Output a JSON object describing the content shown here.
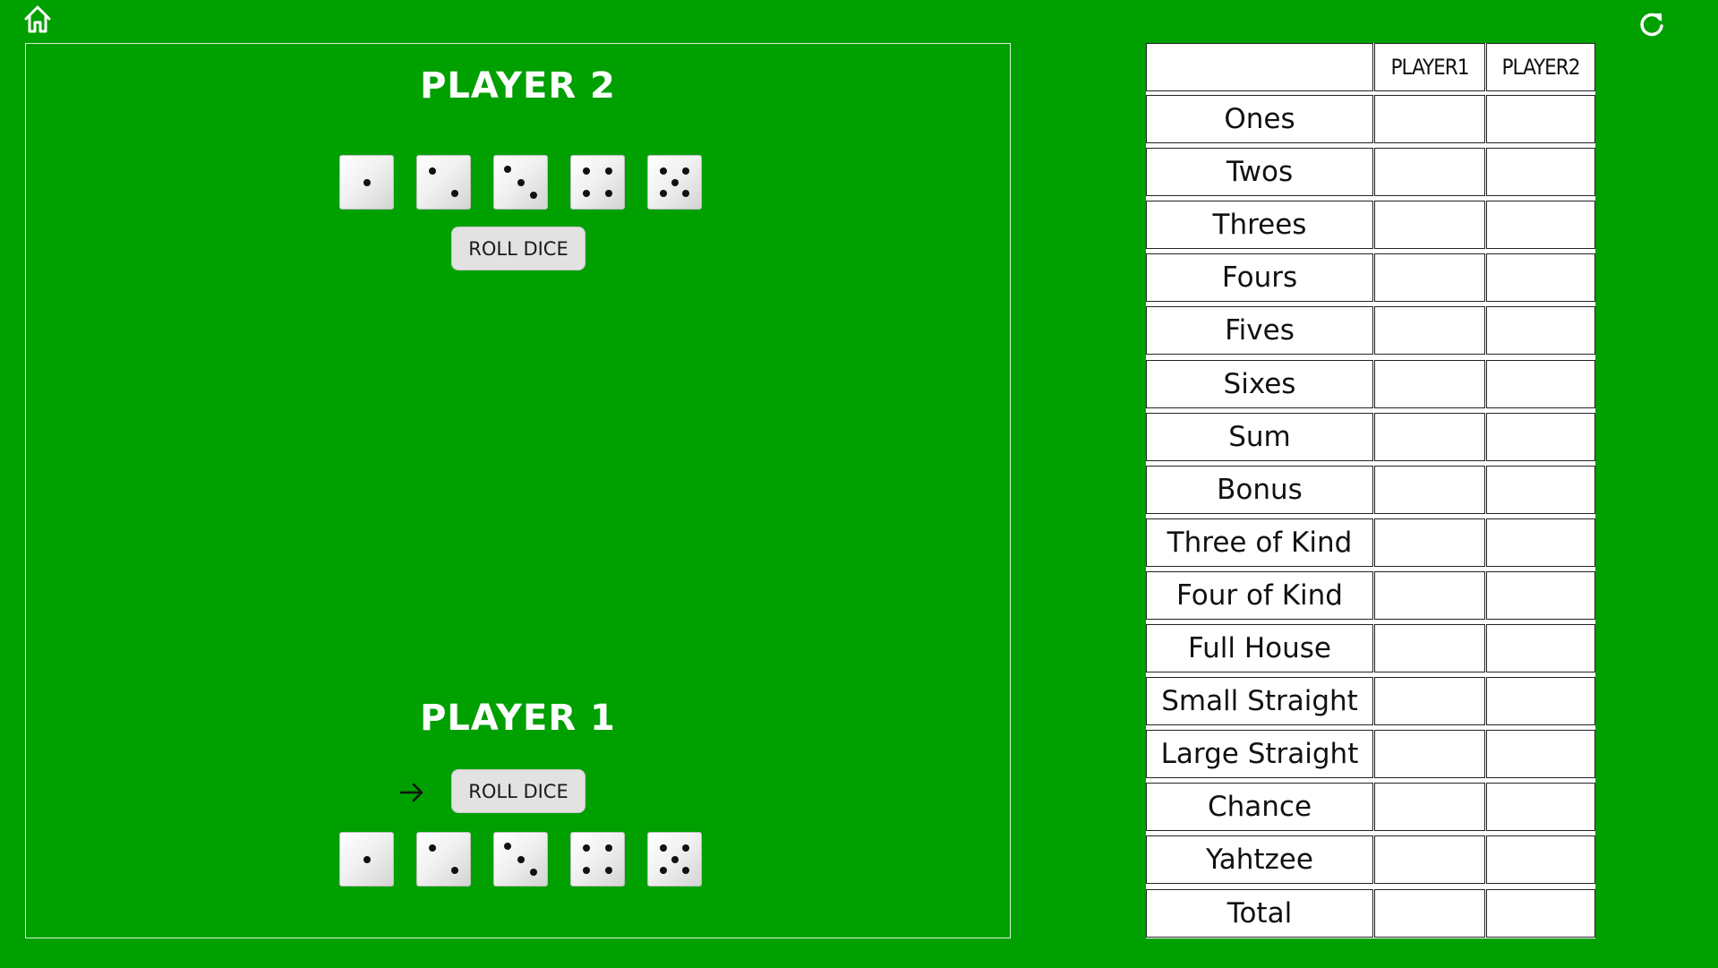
{
  "nav": {
    "home_icon": "home-icon",
    "refresh_icon": "refresh-icon"
  },
  "player2": {
    "title": "PLAYER 2",
    "roll_label": "ROLL DICE",
    "dice": [
      1,
      2,
      3,
      4,
      5
    ]
  },
  "player1": {
    "title": "PLAYER 1",
    "roll_label": "ROLL DICE",
    "dice": [
      1,
      2,
      3,
      4,
      5
    ],
    "turn_indicator_icon": "arrow-right-icon"
  },
  "scorecard": {
    "corner": "",
    "headers": [
      "PLAYER1",
      "PLAYER2"
    ],
    "rows": [
      {
        "label": "Ones",
        "p1": "",
        "p2": ""
      },
      {
        "label": "Twos",
        "p1": "",
        "p2": ""
      },
      {
        "label": "Threes",
        "p1": "",
        "p2": ""
      },
      {
        "label": "Fours",
        "p1": "",
        "p2": ""
      },
      {
        "label": "Fives",
        "p1": "",
        "p2": ""
      },
      {
        "label": "Sixes",
        "p1": "",
        "p2": ""
      },
      {
        "label": "Sum",
        "p1": "",
        "p2": ""
      },
      {
        "label": "Bonus",
        "p1": "",
        "p2": ""
      },
      {
        "label": "Three of Kind",
        "p1": "",
        "p2": ""
      },
      {
        "label": "Four of Kind",
        "p1": "",
        "p2": ""
      },
      {
        "label": "Full House",
        "p1": "",
        "p2": ""
      },
      {
        "label": "Small Straight",
        "p1": "",
        "p2": ""
      },
      {
        "label": "Large Straight",
        "p1": "",
        "p2": ""
      },
      {
        "label": "Chance",
        "p1": "",
        "p2": ""
      },
      {
        "label": "Yahtzee",
        "p1": "",
        "p2": ""
      },
      {
        "label": "Total",
        "p1": "",
        "p2": ""
      }
    ]
  },
  "colors": {
    "background": "#00a000",
    "title_text": "#ffffff",
    "button_bg": "#e2e2e2"
  }
}
